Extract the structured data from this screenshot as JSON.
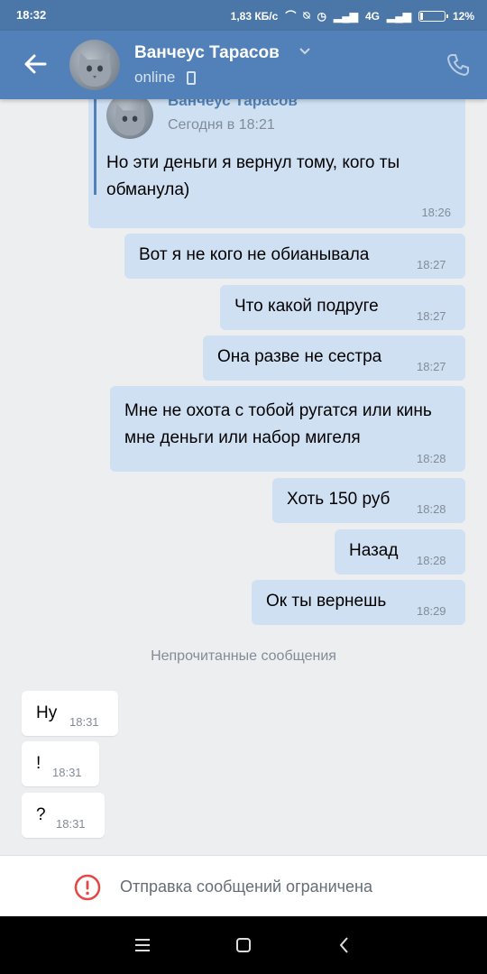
{
  "status_bar": {
    "time": "18:32",
    "net_speed": "1,83 КБ/с",
    "network": "4G",
    "battery": "12%",
    "battery_level": 0.12
  },
  "header": {
    "contact_name": "Ванчеус Тарасов",
    "status": "online",
    "back_icon": "arrow-left-icon",
    "call_icon": "phone-icon"
  },
  "forwarded": {
    "author": "Ванчеус Тарасов",
    "date": "Сегодня в 18:21",
    "text": "Но эти деньги я вернул тому, кого ты обманула)",
    "time": "18:26"
  },
  "messages_out": [
    {
      "text": "Вот я не кого не обианывала",
      "time": "18:27"
    },
    {
      "text": "Что какой подруге",
      "time": "18:27"
    },
    {
      "text": "Она разве не сестра",
      "time": "18:27"
    },
    {
      "text": "Мне не охота с тобой ругатся или кинь мне деньги или набор мигеля",
      "time": "18:28"
    },
    {
      "text": "Хоть 150 руб",
      "time": "18:28"
    },
    {
      "text": "Назад",
      "time": "18:28"
    },
    {
      "text": "Ок ты вернешь",
      "time": "18:29"
    }
  ],
  "unread_label": "Непрочитанные сообщения",
  "messages_in": [
    {
      "text": "Ну",
      "time": "18:31"
    },
    {
      "text": "!",
      "time": "18:31"
    },
    {
      "text": "?",
      "time": "18:31"
    }
  ],
  "bottom_notice": "Отправка сообщений ограничена",
  "colors": {
    "header": "#5181b8",
    "status_bar": "#4a76a8",
    "outgoing_bubble": "#cfe0f2",
    "incoming_bubble": "#ffffff",
    "warning": "#e64646"
  }
}
